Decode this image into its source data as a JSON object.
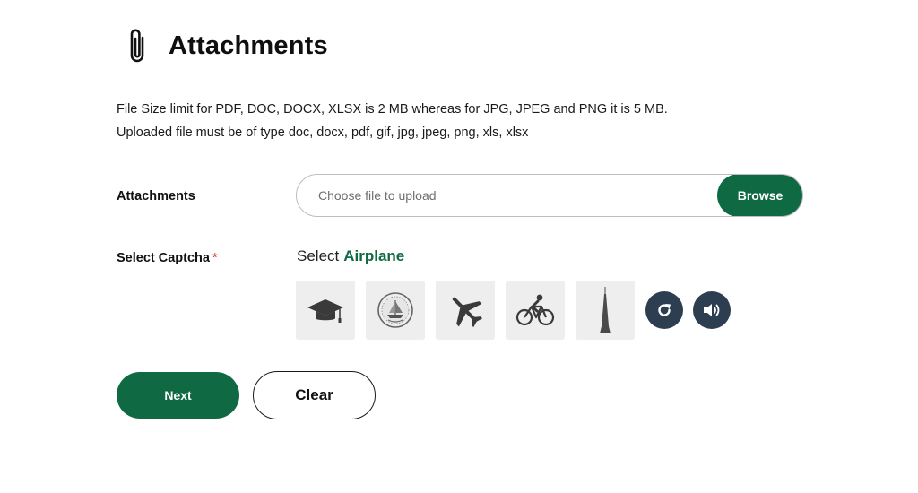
{
  "header": {
    "title": "Attachments",
    "icon": "paperclip-icon"
  },
  "info": {
    "size_limit": "File Size limit for PDF, DOC, DOCX, XLSX is 2 MB whereas for JPG, JPEG and PNG it is 5 MB.",
    "file_types": "Uploaded file must be of type doc, docx, pdf, gif, jpg, jpeg, png, xls, xlsx"
  },
  "attachments": {
    "label": "Attachments",
    "placeholder": "Choose file to upload",
    "browse_label": "Browse"
  },
  "captcha": {
    "label": "Select Captcha",
    "required_mark": "*",
    "prompt": "Select",
    "target": "Airplane",
    "options": [
      {
        "icon": "graduation-cap-icon"
      },
      {
        "icon": "emblem-icon"
      },
      {
        "icon": "airplane-icon"
      },
      {
        "icon": "cyclist-icon"
      },
      {
        "icon": "tower-icon"
      }
    ],
    "refresh_icon": "refresh-icon",
    "audio_icon": "speaker-icon"
  },
  "actions": {
    "next_label": "Next",
    "clear_label": "Clear"
  },
  "colors": {
    "primary": "#0f6a43",
    "round_button": "#2c3e50",
    "tile_bg": "#eeeeee",
    "required": "#d0312d"
  }
}
